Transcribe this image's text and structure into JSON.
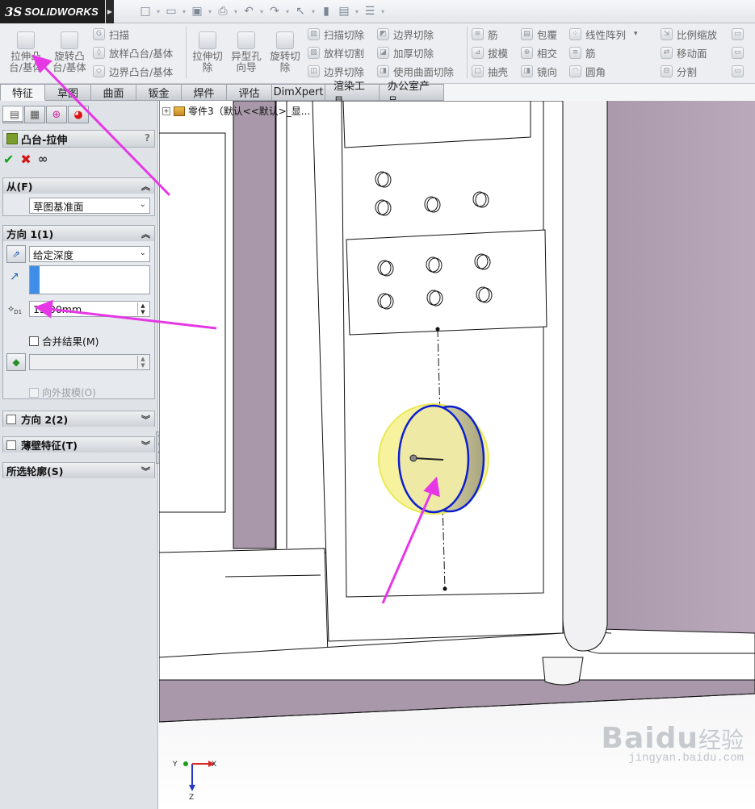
{
  "app": {
    "brand_ds": "3S",
    "brand_name": "SOLIDWORKS"
  },
  "quick_toolbar": [
    "new-icon",
    "open-icon",
    "save-icon",
    "print-icon",
    "undo-icon",
    "redo-icon",
    "select-icon",
    "rebuild-icon",
    "file-properties-icon",
    "options-icon"
  ],
  "ribbon": {
    "extrude_boss": "拉伸凸\n台/基体",
    "revolve_boss": "旋转凸\n台/基体",
    "sweep": "扫描",
    "loft_boss": "放样凸台/基体",
    "boundary_boss": "边界凸台/基体",
    "extrude_cut": "拉伸切\n除",
    "hole_wizard": "异型孔\n向导",
    "revolve_cut": "旋转切\n除",
    "swept_cut": "扫描切除",
    "lofted_cut": "放样切割",
    "boundary_cut": "边界切除",
    "boundary_cut2": "边界切除",
    "thicken_cut": "加厚切除",
    "surface_cut": "使用曲面切除",
    "rib": "筋",
    "draft": "拔模",
    "shell": "抽壳",
    "wrap": "包覆",
    "intersect": "相交",
    "mirror": "镜向",
    "linear_pattern": "线性阵列",
    "rib2": "筋",
    "fillet": "圆角",
    "scale": "比例缩放",
    "move_face": "移动面",
    "split": "分割"
  },
  "tabs": [
    "特征",
    "草图",
    "曲面",
    "钣金",
    "焊件",
    "评估",
    "DimXpert",
    "渲染工具",
    "办公室产品"
  ],
  "active_tab": "特征",
  "panel": {
    "title": "凸台-拉伸",
    "help": "?",
    "ok": "✔",
    "cancel": "✖",
    "preview": "∞",
    "from": {
      "label": "从(F)",
      "value": "草图基准面"
    },
    "dir1": {
      "label": "方向 1(1)",
      "end_condition": "给定深度",
      "depth": "15.00mm",
      "merge_label": "合并结果(M)",
      "draft_label": "向外拔模(O)"
    },
    "dir2": {
      "label": "方向 2(2)"
    },
    "thin": {
      "label": "薄壁特征(T)"
    },
    "contours": {
      "label": "所选轮廓(S)"
    }
  },
  "tree": {
    "item": "零件3（默认<<默认>_显..."
  },
  "triad": {
    "x": "X",
    "y": "Y",
    "z": "Z"
  },
  "watermark": {
    "main": "Bai",
    "paw": "du",
    "cn": "经验",
    "url": "jingyan.baidu.com"
  },
  "colors": {
    "accent": "#e637e6",
    "sketch_blue": "#0b1fd1",
    "preview_yellow": "#f6f08e"
  }
}
